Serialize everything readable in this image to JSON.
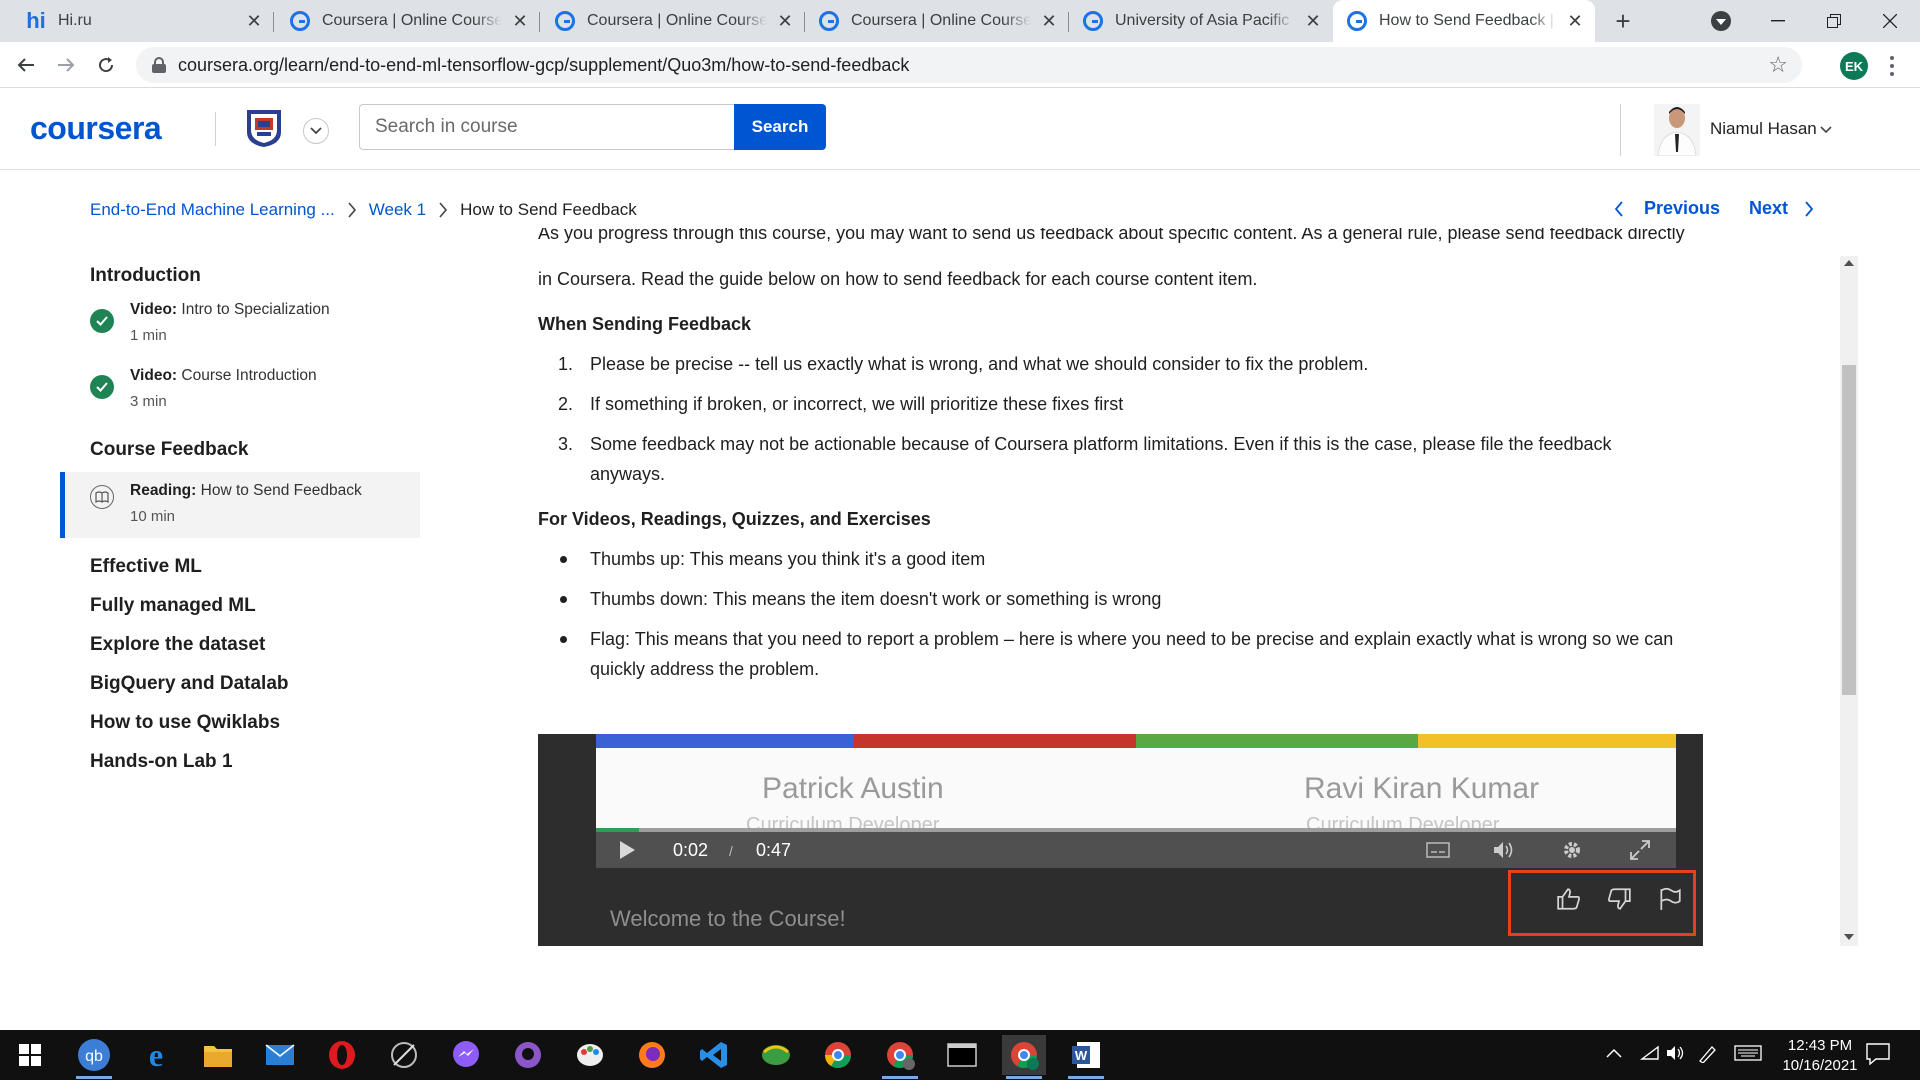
{
  "browser": {
    "tabs": [
      {
        "title": "Hi.ru",
        "icon": "hi-logo",
        "active": false
      },
      {
        "title": "Coursera | Online Courses & Credentials",
        "icon": "coursera-c",
        "active": false
      },
      {
        "title": "Coursera | Online Courses & Credentials",
        "icon": "coursera-c",
        "active": false
      },
      {
        "title": "Coursera | Online Courses & Credentials",
        "icon": "coursera-c",
        "active": false
      },
      {
        "title": "University of Asia Pacific on Coursera",
        "icon": "coursera-c",
        "active": false
      },
      {
        "title": "How to Send Feedback | Coursera",
        "icon": "coursera-c",
        "active": true
      }
    ],
    "hi_logo_text": "hi",
    "url": "coursera.org/learn/end-to-end-ml-tensorflow-gcp/supplement/Quo3m/how-to-send-feedback",
    "profile_initials": "EK"
  },
  "header": {
    "logo": "coursera",
    "search_placeholder": "Search in course",
    "search_button": "Search",
    "user_name": "Niamul Hasan"
  },
  "breadcrumb": {
    "course": "End-to-End Machine Learning ...",
    "week": "Week 1",
    "current": "How to Send Feedback",
    "previous": "Previous",
    "next": "Next"
  },
  "sidebar": {
    "sections": [
      {
        "title": "Introduction"
      },
      {
        "title": "Course Feedback"
      },
      {
        "title": "Effective ML"
      },
      {
        "title": "Fully managed ML"
      },
      {
        "title": "Explore the dataset"
      },
      {
        "title": "BigQuery and Datalab"
      },
      {
        "title": "How to use Qwiklabs"
      },
      {
        "title": "Hands-on Lab 1"
      }
    ],
    "items": [
      {
        "type": "Video:",
        "title": "Intro to Specialization",
        "duration": "1 min",
        "status": "completed"
      },
      {
        "type": "Video:",
        "title": "Course Introduction",
        "duration": "3 min",
        "status": "completed"
      },
      {
        "type": "Reading:",
        "title": "How to Send Feedback",
        "duration": "10 min",
        "status": "current"
      }
    ]
  },
  "content": {
    "intro_line1_partial": "As you progress through this course, you may want to send us feedback about specific content. As a general rule, please send feedback directly",
    "intro_line2": "in Coursera.  Read the guide below on how to send feedback for each course content item.",
    "heading1": "When Sending Feedback",
    "list1": [
      "Please be precise -- tell us exactly what is wrong, and what we should consider to fix the problem.",
      "If something if broken, or incorrect, we will prioritize these fixes first",
      "Some feedback may not be actionable because of Coursera platform limitations.  Even if this is the case, please file the feedback anyways."
    ],
    "heading2": "For Videos, Readings, Quizzes, and Exercises",
    "list2": [
      "Thumbs up: This means you think it's a good item",
      "Thumbs down: This means the item doesn't work or something is wrong",
      "Flag: This means that you need to report a problem – here is where you need to be precise and explain exactly what is wrong so we can quickly address the problem."
    ]
  },
  "video": {
    "speaker1_name": "Patrick Austin",
    "speaker1_role": "Curriculum Developer",
    "speaker2_name": "Ravi Kiran Kumar",
    "speaker2_role": "Curriculum Developer",
    "current_time": "0:02",
    "time_sep": "/",
    "duration": "0:47",
    "progress_fraction": 0.04,
    "caption": "Welcome to the Course!",
    "highlight_color": "#e5421c"
  },
  "taskbar": {
    "time": "12:43 PM",
    "date": "10/16/2021"
  },
  "colors": {
    "brand": "#0056d2",
    "completed": "#1f8354"
  }
}
